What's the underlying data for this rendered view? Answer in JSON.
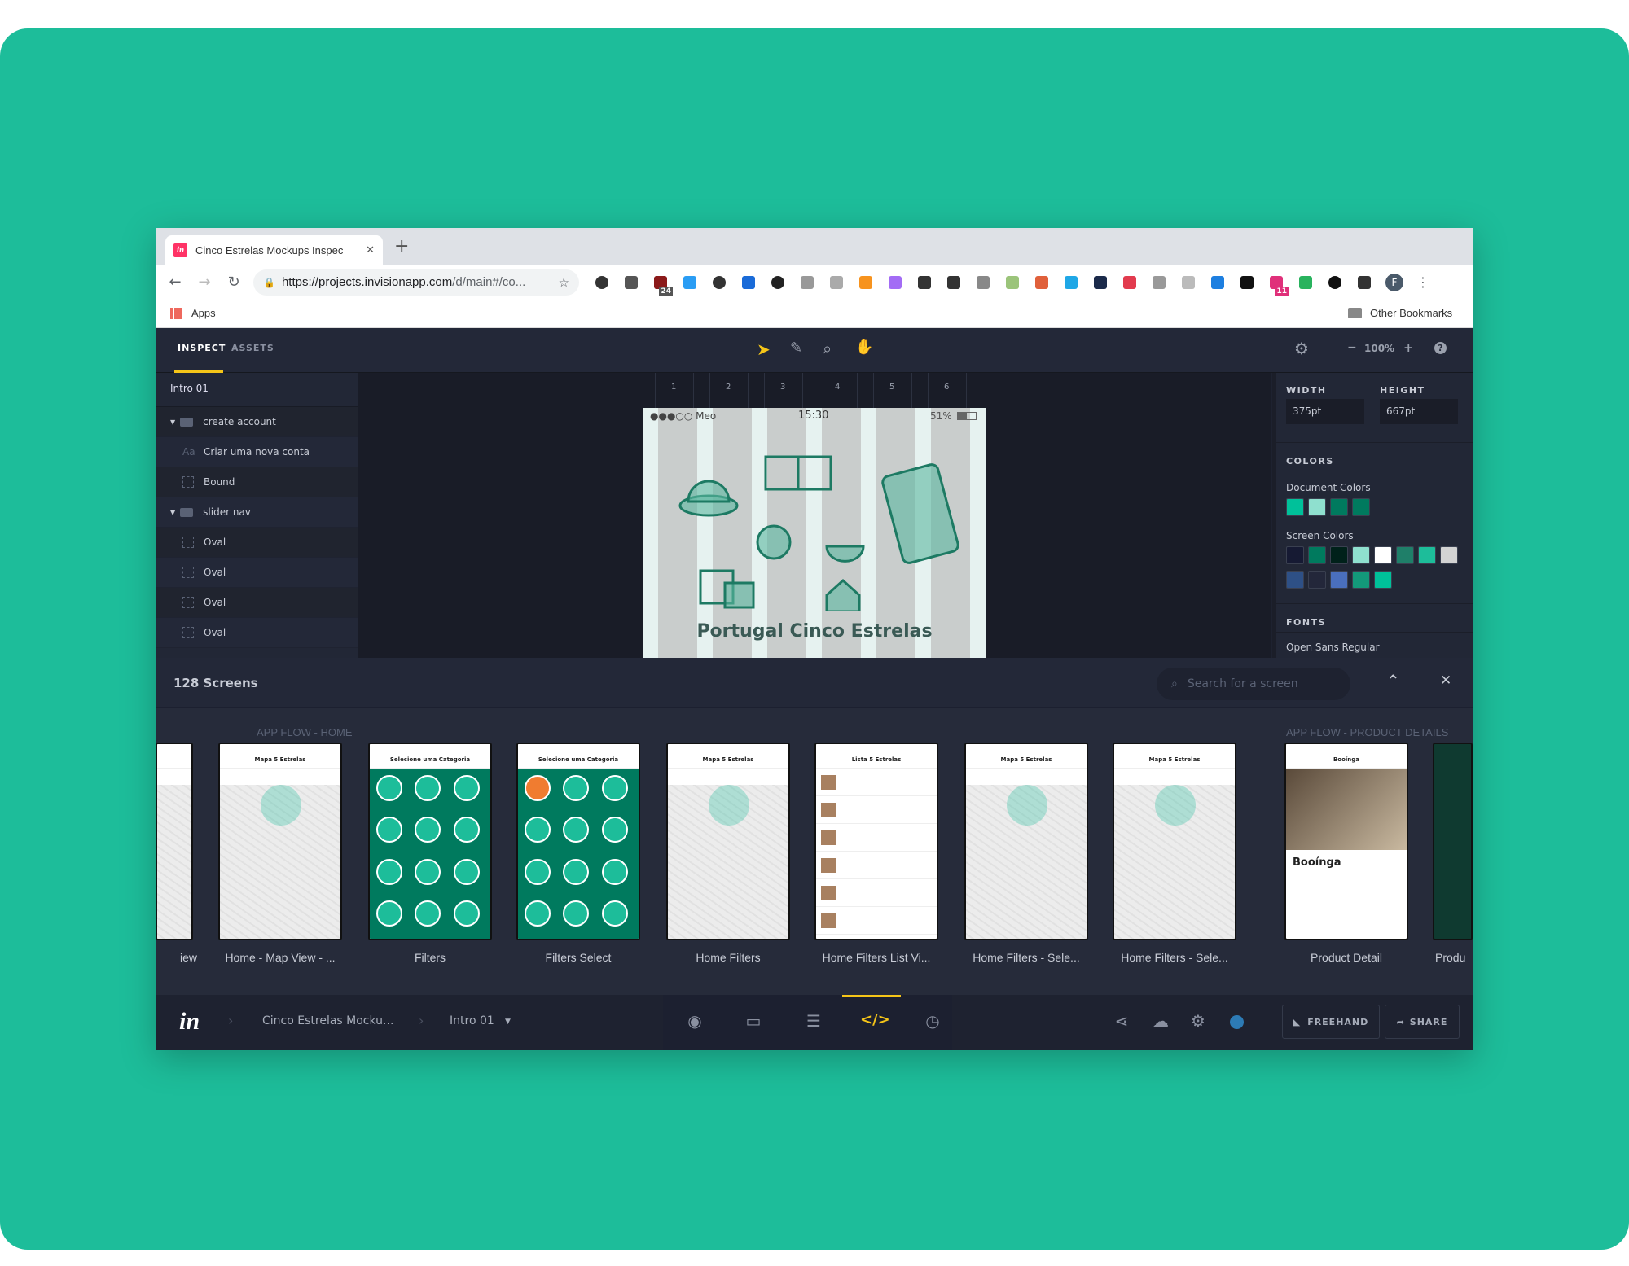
{
  "browser": {
    "tab_title": "Cinco Estrelas Mockups Inspec",
    "url_host": "https://projects.invisionapp.com",
    "url_path": "/d/main#/co...",
    "bookmarks": {
      "apps": "Apps",
      "other": "Other Bookmarks"
    },
    "profile_initial": "F",
    "ext_badges": {
      "b1": "24",
      "b2": "11"
    }
  },
  "toolbar": {
    "tab_inspect": "INSPECT",
    "tab_assets": "ASSETS",
    "zoom": "100%",
    "zoom_minus": "−",
    "zoom_plus": "+"
  },
  "layers": {
    "screen_name": "Intro 01",
    "items": [
      {
        "label": "create account",
        "type": "folder"
      },
      {
        "label": "Criar uma nova conta",
        "type": "text"
      },
      {
        "label": "Bound",
        "type": "shape"
      },
      {
        "label": "slider nav",
        "type": "folder"
      },
      {
        "label": "Oval",
        "type": "shape"
      },
      {
        "label": "Oval",
        "type": "shape"
      },
      {
        "label": "Oval",
        "type": "shape"
      },
      {
        "label": "Oval",
        "type": "shape"
      }
    ]
  },
  "canvas": {
    "columns": [
      "1",
      "2",
      "3",
      "4",
      "5",
      "6"
    ],
    "status": {
      "carrier": "●●●○○ Meo",
      "time": "15:30",
      "battery": "51%"
    },
    "title": "Portugal Cinco Estrelas"
  },
  "inspector": {
    "width_label": "WIDTH",
    "width": "375pt",
    "height_label": "HEIGHT",
    "height": "667pt",
    "colors_label": "COLORS",
    "doc_colors_label": "Document Colors",
    "doc_colors": [
      "#00c19a",
      "#8fe0cf",
      "#007a5e",
      "#007a5e"
    ],
    "screen_colors_label": "Screen Colors",
    "screen_colors": [
      "#161a33",
      "#007a5e",
      "#00211a",
      "#8fe0cf",
      "#ffffff",
      "#1f7f69",
      "#1dbd9a",
      "#d3d3d3",
      "#2e5086",
      "#23273a",
      "#4a6fbd",
      "#13997a",
      "#00c19a"
    ],
    "fonts_label": "FONTS",
    "font": "Open Sans Regular"
  },
  "drawer": {
    "count": "128 Screens",
    "search_placeholder": "Search for a screen",
    "flows": [
      "APP FLOW - HOME",
      "APP FLOW - PRODUCT DETAILS"
    ],
    "screens": [
      {
        "label": "iew",
        "kind": "map",
        "title": ""
      },
      {
        "label": "Home - Map View - ...",
        "kind": "map",
        "title": "Mapa 5 Estrelas"
      },
      {
        "label": "Filters",
        "kind": "filters",
        "title": "Selecione uma Categoria"
      },
      {
        "label": "Filters Select",
        "kind": "filters",
        "title": "Selecione uma Categoria"
      },
      {
        "label": "Home Filters",
        "kind": "map",
        "title": "Mapa 5 Estrelas"
      },
      {
        "label": "Home Filters List Vi...",
        "kind": "list",
        "title": "Lista 5 Estrelas"
      },
      {
        "label": "Home Filters - Sele...",
        "kind": "map",
        "title": "Mapa 5 Estrelas"
      },
      {
        "label": "Home Filters - Sele...",
        "kind": "map",
        "title": "Mapa 5 Estrelas"
      },
      {
        "label": "Product Detail",
        "kind": "detail",
        "title": "Booínga"
      },
      {
        "label": "Produ",
        "kind": "dark",
        "title": ""
      }
    ]
  },
  "bottom": {
    "project": "Cinco Estrelas Mocku...",
    "screen": "Intro 01",
    "freehand": "FREEHAND",
    "share": "SHARE"
  },
  "colors": {
    "accent": "#f5c518",
    "brand": "#ff3366",
    "background": "#1dbd9a"
  }
}
